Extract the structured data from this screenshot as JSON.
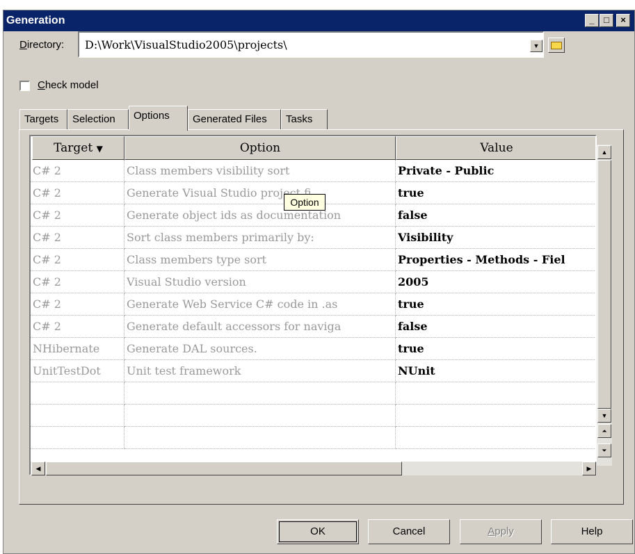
{
  "window": {
    "title": "Generation"
  },
  "directory": {
    "label": "Directory:",
    "value": "D:\\Work\\VisualStudio2005\\projects\\"
  },
  "check_model": {
    "label": "Check model",
    "checked": false
  },
  "tabs": [
    {
      "label": "Targets"
    },
    {
      "label": "Selection"
    },
    {
      "label": "Options",
      "active": true
    },
    {
      "label": "Generated Files"
    },
    {
      "label": "Tasks"
    }
  ],
  "grid": {
    "headers": {
      "target": "Target",
      "option": "Option",
      "value": "Value"
    },
    "rows": [
      {
        "target": "C# 2",
        "option": "Class members visibility sort",
        "value": "Private - Public"
      },
      {
        "target": "C# 2",
        "option": "Generate Visual Studio project fi",
        "value": "true"
      },
      {
        "target": "C# 2",
        "option": "Generate object ids as documentation",
        "value": "false"
      },
      {
        "target": "C# 2",
        "option": "Sort class members primarily by:",
        "value": "Visibility"
      },
      {
        "target": "C# 2",
        "option": "Class members type sort",
        "value": "Properties - Methods - Fiel"
      },
      {
        "target": "C# 2",
        "option": "Visual Studio version",
        "value": "2005"
      },
      {
        "target": "C# 2",
        "option": "Generate Web Service C# code in .as",
        "value": "true"
      },
      {
        "target": "C# 2",
        "option": "Generate default accessors for naviga",
        "value": "false"
      },
      {
        "target": "NHibernate",
        "option": "Generate DAL sources.",
        "value": "true"
      },
      {
        "target": "UnitTestDot",
        "option": "Unit test framework",
        "value": "NUnit"
      }
    ]
  },
  "tooltip": {
    "text": "Option"
  },
  "buttons": {
    "ok": "OK",
    "cancel": "Cancel",
    "apply": "Apply",
    "help": "Help"
  }
}
